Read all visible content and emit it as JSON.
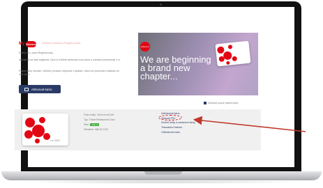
{
  "page": {
    "logo_prefix": "My",
    "logo_brand": "Edenred",
    "heading": "Karolina Karolína Registrovaná",
    "intro": [
      "Dobrý den, pane Registrovaný,",
      "děkujeme za vaši registraci. Nyní si můžete aktivovat svou kartu a zobrazit podrobnosti o ní.",
      "Pokud kartu nemáte, můžete ji snadno objednat v aplikaci. Kartu lze používat k platbám po celé zemi."
    ],
    "activate_label": "Aktivovat kartu"
  },
  "banner": {
    "logo_text": "Edenred",
    "lines": [
      "We are beginning",
      "a brand new",
      "chapter..."
    ]
  },
  "manage_note": "Zobrazit pouze platné karty",
  "card": {
    "number_masked": "•••• 0000",
    "rows": [
      "Číslo karty: 1114•••••••0149",
      "Typ: Ticket Restaurant Card",
      "Zůstatek: 988,00 CZK"
    ],
    "status_label": "Stav:",
    "status_badge": "Aktivní",
    "actions": [
      "Zablokovat kartu",
      "Zobrazit PIN",
      "Změnit limity a nastavení karty",
      "Transakční historie",
      "Odblokovat kartu"
    ]
  },
  "colors": {
    "brand_red": "#e30613",
    "primary_navy": "#2a3a66",
    "success_green": "#3aaa35",
    "annotation_red": "#c0392b"
  }
}
